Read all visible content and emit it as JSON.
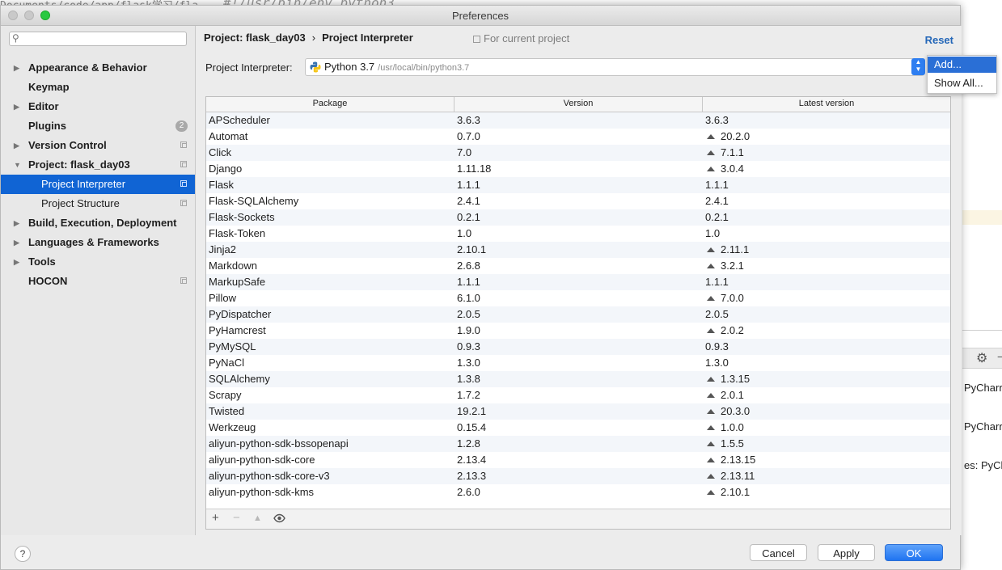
{
  "background": {
    "path_text": "Documents/code/app/flask学习/fla",
    "code_text": "#!/usr/bin/env python3",
    "side_texts": [
      "PyCharr",
      "PyCharr",
      "es: PyCha"
    ]
  },
  "window": {
    "title": "Preferences"
  },
  "sidebar": {
    "search_placeholder": "",
    "items": [
      {
        "label": "Appearance & Behavior",
        "arrow": "▶"
      },
      {
        "label": "Keymap",
        "arrow": ""
      },
      {
        "label": "Editor",
        "arrow": "▶"
      },
      {
        "label": "Plugins",
        "arrow": "",
        "badge": "2"
      },
      {
        "label": "Version Control",
        "arrow": "▶"
      },
      {
        "label": "Project: flask_day03",
        "arrow": "▼"
      },
      {
        "label": "Project Interpreter",
        "arrow": ""
      },
      {
        "label": "Project Structure",
        "arrow": ""
      },
      {
        "label": "Build, Execution, Deployment",
        "arrow": "▶"
      },
      {
        "label": "Languages & Frameworks",
        "arrow": "▶"
      },
      {
        "label": "Tools",
        "arrow": "▶"
      },
      {
        "label": "HOCON",
        "arrow": ""
      }
    ]
  },
  "main": {
    "breadcrumb_project": "Project: flask_day03",
    "breadcrumb_sep": "›",
    "breadcrumb_page": "Project Interpreter",
    "scope_label": "For current project",
    "reset_label": "Reset",
    "interpreter_label": "Project Interpreter:",
    "interpreter_name": "Python 3.7",
    "interpreter_path": "/usr/local/bin/python3.7",
    "table": {
      "headers": [
        "Package",
        "Version",
        "Latest version"
      ],
      "rows": [
        {
          "name": "APScheduler",
          "version": "3.6.3",
          "latest": "3.6.3",
          "upgrade": false
        },
        {
          "name": "Automat",
          "version": "0.7.0",
          "latest": "20.2.0",
          "upgrade": true
        },
        {
          "name": "Click",
          "version": "7.0",
          "latest": "7.1.1",
          "upgrade": true
        },
        {
          "name": "Django",
          "version": "1.11.18",
          "latest": "3.0.4",
          "upgrade": true
        },
        {
          "name": "Flask",
          "version": "1.1.1",
          "latest": "1.1.1",
          "upgrade": false
        },
        {
          "name": "Flask-SQLAlchemy",
          "version": "2.4.1",
          "latest": "2.4.1",
          "upgrade": false
        },
        {
          "name": "Flask-Sockets",
          "version": "0.2.1",
          "latest": "0.2.1",
          "upgrade": false
        },
        {
          "name": "Flask-Token",
          "version": "1.0",
          "latest": "1.0",
          "upgrade": false
        },
        {
          "name": "Jinja2",
          "version": "2.10.1",
          "latest": "2.11.1",
          "upgrade": true
        },
        {
          "name": "Markdown",
          "version": "2.6.8",
          "latest": "3.2.1",
          "upgrade": true
        },
        {
          "name": "MarkupSafe",
          "version": "1.1.1",
          "latest": "1.1.1",
          "upgrade": false
        },
        {
          "name": "Pillow",
          "version": "6.1.0",
          "latest": "7.0.0",
          "upgrade": true
        },
        {
          "name": "PyDispatcher",
          "version": "2.0.5",
          "latest": "2.0.5",
          "upgrade": false
        },
        {
          "name": "PyHamcrest",
          "version": "1.9.0",
          "latest": "2.0.2",
          "upgrade": true
        },
        {
          "name": "PyMySQL",
          "version": "0.9.3",
          "latest": "0.9.3",
          "upgrade": false
        },
        {
          "name": "PyNaCl",
          "version": "1.3.0",
          "latest": "1.3.0",
          "upgrade": false
        },
        {
          "name": "SQLAlchemy",
          "version": "1.3.8",
          "latest": "1.3.15",
          "upgrade": true
        },
        {
          "name": "Scrapy",
          "version": "1.7.2",
          "latest": "2.0.1",
          "upgrade": true
        },
        {
          "name": "Twisted",
          "version": "19.2.1",
          "latest": "20.3.0",
          "upgrade": true
        },
        {
          "name": "Werkzeug",
          "version": "0.15.4",
          "latest": "1.0.0",
          "upgrade": true
        },
        {
          "name": "aliyun-python-sdk-bssopenapi",
          "version": "1.2.8",
          "latest": "1.5.5",
          "upgrade": true
        },
        {
          "name": "aliyun-python-sdk-core",
          "version": "2.13.4",
          "latest": "2.13.15",
          "upgrade": true
        },
        {
          "name": "aliyun-python-sdk-core-v3",
          "version": "2.13.3",
          "latest": "2.13.11",
          "upgrade": true
        },
        {
          "name": "aliyun-python-sdk-kms",
          "version": "2.6.0",
          "latest": "2.10.1",
          "upgrade": true
        }
      ]
    },
    "toolbar": {
      "add": "+",
      "remove": "−",
      "upgrade": "▲",
      "show": "👁"
    }
  },
  "popup": {
    "items": [
      "Add...",
      "Show All..."
    ]
  },
  "footer": {
    "help": "?",
    "cancel": "Cancel",
    "apply": "Apply",
    "ok": "OK"
  },
  "colors": {
    "selection": "#1064d4",
    "accent_button": "#1f74f1",
    "reset_link": "#2467b8"
  }
}
